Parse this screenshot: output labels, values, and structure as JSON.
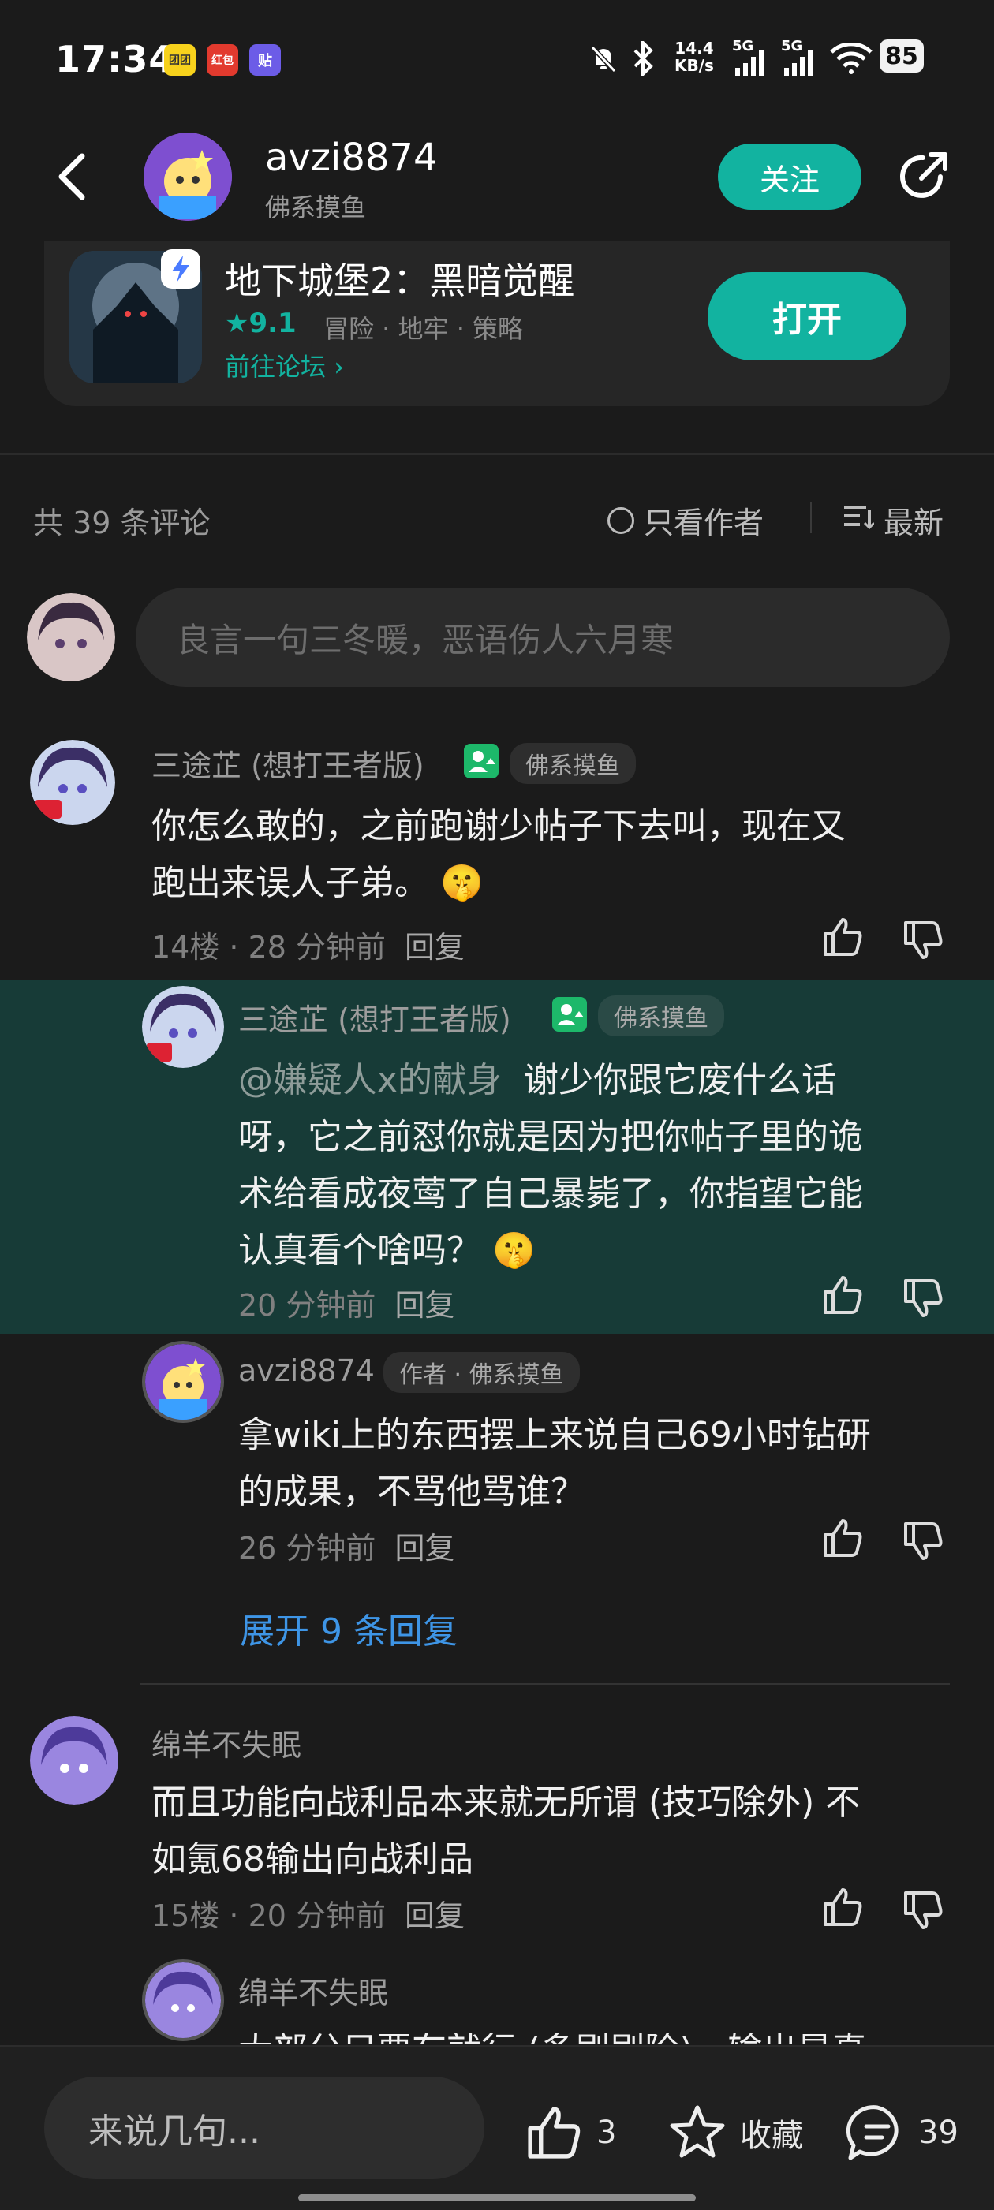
{
  "status_bar": {
    "time": "17:34",
    "apps": [
      "团团",
      "红包",
      "贴"
    ],
    "net_speed_value": "14.4",
    "net_speed_unit": "KB/s",
    "signal_1": "5G",
    "signal_2": "5G",
    "battery": "85"
  },
  "header": {
    "username": "avzi8874",
    "subtitle": "佛系摸鱼",
    "follow_label": "关注"
  },
  "game_card": {
    "title": "地下城堡2：黑暗觉醒",
    "rating": "9.1",
    "tags": "冒险 · 地牢 · 策略",
    "forum_link": "前往论坛",
    "open_label": "打开"
  },
  "comments_header": {
    "count": "共 39 条评论",
    "author_only": "只看作者",
    "sort": "最新"
  },
  "comment_input": {
    "placeholder": "良言一句三冬暖，恶语伤人六月寒"
  },
  "comments": [
    {
      "name": "三途芷 (想打王者版)",
      "tag": "佛系摸鱼",
      "text_line1": "你怎么敢的，之前跑谢少帖子下去叫，现在又",
      "text_line2": "跑出来误人子弟。",
      "meta": "14楼 · 28 分钟前",
      "reply": "回复"
    },
    {
      "name": "三途芷 (想打王者版)",
      "tag": "佛系摸鱼",
      "mention": "@嫌疑人x的献身",
      "text_line1": "谢少你跟它废什么话",
      "text_line2": "呀，它之前怼你就是因为把你帖子里的诡",
      "text_line3": "术给看成夜莺了自己暴毙了，你指望它能",
      "text_line4": "认真看个啥吗？",
      "meta": "20 分钟前",
      "reply": "回复"
    },
    {
      "name": "avzi8874",
      "tag": "作者 · 佛系摸鱼",
      "text_line1": "拿wiki上的东西摆上来说自己69小时钻研",
      "text_line2": "的成果，不骂他骂谁？",
      "meta": "26 分钟前",
      "reply": "回复"
    },
    {
      "name": "绵羊不失眠",
      "text_line1": "而且功能向战利品本来就无所谓 (技巧除外) 不",
      "text_line2": "如氪68输出向战利品",
      "meta": "15楼 · 20 分钟前",
      "reply": "回复"
    },
    {
      "name": "绵羊不失眠",
      "text_line1": "大部分只要有就行 (多刷刷险)，输出是真"
    }
  ],
  "expand_replies": "展开 9 条回复",
  "bottom_bar": {
    "placeholder": "来说几句...",
    "likes": "3",
    "favorite": "收藏",
    "comments": "39"
  },
  "colors": {
    "accent": "#12b3a0",
    "highlight": "#173b37",
    "link": "#3e95e6"
  }
}
